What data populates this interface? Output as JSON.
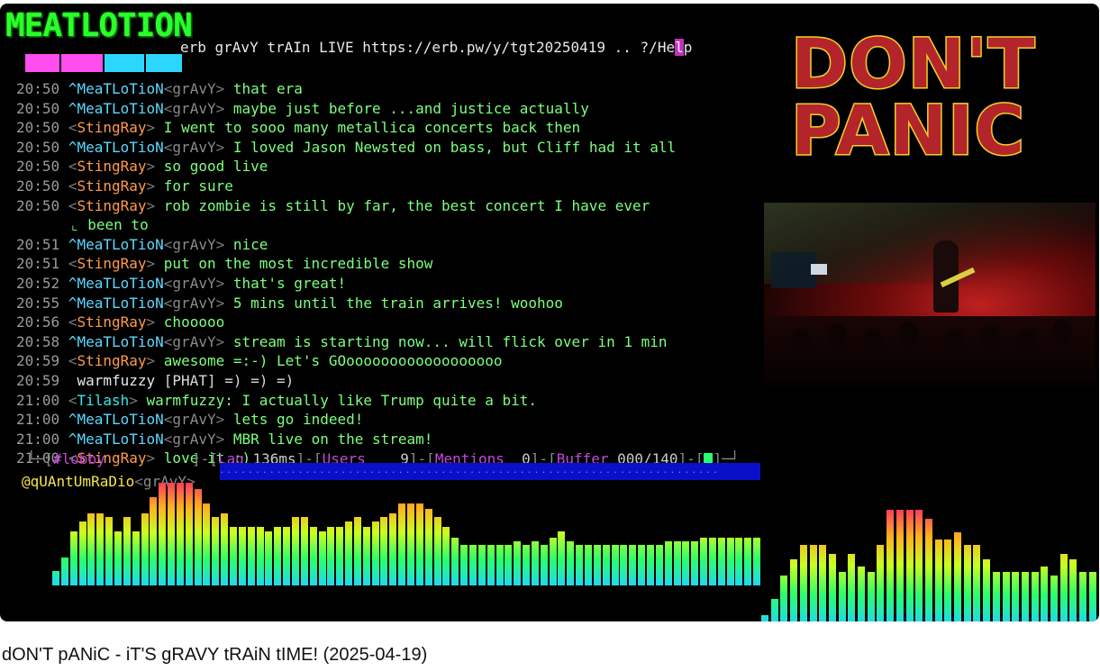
{
  "video": {
    "logo_text": "MEATLOTION",
    "topic": "erb grAvY trAIn LIVE https://erb.pw/y/tgt20250419",
    "topic_tail": " .. ?/He",
    "topic_hl": "l",
    "topic_end": "p",
    "messages": [
      {
        "time": "20:50",
        "nick": "^MeaTLoTioN",
        "suffix": "grAvY",
        "kind": "op",
        "text": "that era"
      },
      {
        "time": "20:50",
        "nick": "^MeaTLoTioN",
        "suffix": "grAvY",
        "kind": "op",
        "text": "maybe just before ...and justice actually"
      },
      {
        "time": "20:50",
        "nick": "StingRay",
        "kind": "sr",
        "text": "I went to sooo many metallica concerts back then"
      },
      {
        "time": "20:50",
        "nick": "^MeaTLoTioN",
        "suffix": "grAvY",
        "kind": "op",
        "text": "I loved Jason Newsted on bass, but Cliff had it all"
      },
      {
        "time": "20:50",
        "nick": "StingRay",
        "kind": "sr",
        "text": "so good live"
      },
      {
        "time": "20:50",
        "nick": "StingRay",
        "kind": "sr",
        "text": "for sure"
      },
      {
        "time": "20:50",
        "nick": "StingRay",
        "kind": "sr",
        "text": "rob zombie is still by far, the best concert I have ever"
      },
      {
        "time": "",
        "kind": "cont",
        "text": "⌞ been to"
      },
      {
        "time": "20:51",
        "nick": "^MeaTLoTioN",
        "suffix": "grAvY",
        "kind": "op",
        "text": "nice"
      },
      {
        "time": "20:51",
        "nick": "StingRay",
        "kind": "sr",
        "text": "put on the most incredible show"
      },
      {
        "time": "20:52",
        "nick": "^MeaTLoTioN",
        "suffix": "grAvY",
        "kind": "op",
        "text": "that's great!"
      },
      {
        "time": "20:55",
        "nick": "^MeaTLoTioN",
        "suffix": "grAvY",
        "kind": "op",
        "text": "5 mins until the train arrives! woohoo"
      },
      {
        "time": "20:56",
        "nick": "StingRay",
        "kind": "sr",
        "text": "chooooo"
      },
      {
        "time": "20:58",
        "nick": "^MeaTLoTioN",
        "suffix": "grAvY",
        "kind": "op",
        "text": "stream is starting now... will flick over in 1 min"
      },
      {
        "time": "20:59",
        "nick": "StingRay",
        "kind": "sr",
        "text": "awesome =:-)   Let's GOoooooooooooooooooo"
      },
      {
        "time": "20:59",
        "nick": "warmfuzzy",
        "kind": "plain",
        "text": "[PHAT] =) =) =)"
      },
      {
        "time": "21:00",
        "nick": "Tilash",
        "kind": "tl",
        "text": "warmfuzzy: I actually like Trump quite a bit."
      },
      {
        "time": "21:00",
        "nick": "^MeaTLoTioN",
        "suffix": "grAvY",
        "kind": "op",
        "text": "lets go indeed!"
      },
      {
        "time": "21:00",
        "nick": "^MeaTLoTioN",
        "suffix": "grAvY",
        "kind": "op",
        "text": "MBR live on the stream!"
      },
      {
        "time": "21:00",
        "nick": "StingRay",
        "kind": "sr",
        "text": "love it :)"
      }
    ],
    "status": {
      "channel": "#lobby",
      "lag_label": "Lag",
      "lag_value": "136ms",
      "users_label": "Users",
      "users_value": "9",
      "mentions_label": "Mentions",
      "mentions_value": "0",
      "buffer_label": "Buffer",
      "buffer_value": "000/140"
    },
    "input": {
      "nick": "@qUAntUmRaDio",
      "suffix": "grAvY"
    },
    "poster": {
      "line1": "DON'T",
      "line2": "PANIC"
    },
    "colors": {
      "op_nick": "#5fd7ff",
      "stingray_nick": "#ff9b4a",
      "message_text": "#7dff7d",
      "poster_red": "#b3252a",
      "poster_yellow": "#f2d129"
    },
    "visualizer_left": [
      0.07,
      0.14,
      0.27,
      0.32,
      0.36,
      0.36,
      0.34,
      0.27,
      0.34,
      0.27,
      0.36,
      0.44,
      0.51,
      0.51,
      0.51,
      0.51,
      0.48,
      0.41,
      0.34,
      0.36,
      0.29,
      0.29,
      0.29,
      0.29,
      0.27,
      0.29,
      0.29,
      0.34,
      0.34,
      0.29,
      0.27,
      0.29,
      0.29,
      0.32,
      0.34,
      0.29,
      0.32,
      0.34,
      0.36,
      0.41,
      0.41,
      0.41,
      0.38,
      0.34,
      0.29,
      0.24,
      0.2,
      0.2,
      0.2,
      0.2,
      0.2,
      0.2,
      0.22,
      0.2,
      0.22,
      0.2,
      0.24,
      0.27,
      0.22,
      0.2,
      0.2,
      0.2,
      0.2,
      0.2,
      0.2,
      0.2,
      0.2,
      0.2,
      0.2,
      0.22,
      0.22,
      0.22,
      0.22,
      0.24,
      0.24,
      0.24,
      0.24,
      0.24,
      0.24,
      0.24
    ],
    "visualizer_right": [
      0.05,
      0.14,
      0.27,
      0.36,
      0.44,
      0.44,
      0.44,
      0.39,
      0.29,
      0.39,
      0.32,
      0.29,
      0.44,
      0.64,
      0.64,
      0.64,
      0.64,
      0.59,
      0.47,
      0.47,
      0.51,
      0.44,
      0.44,
      0.36,
      0.29,
      0.29,
      0.29,
      0.29,
      0.29,
      0.32,
      0.27,
      0.39,
      0.36,
      0.29,
      0.29
    ]
  },
  "caption": "dON'T pANiC - iT'S gRAVY tRAiN tIME! (2025-04-19)"
}
